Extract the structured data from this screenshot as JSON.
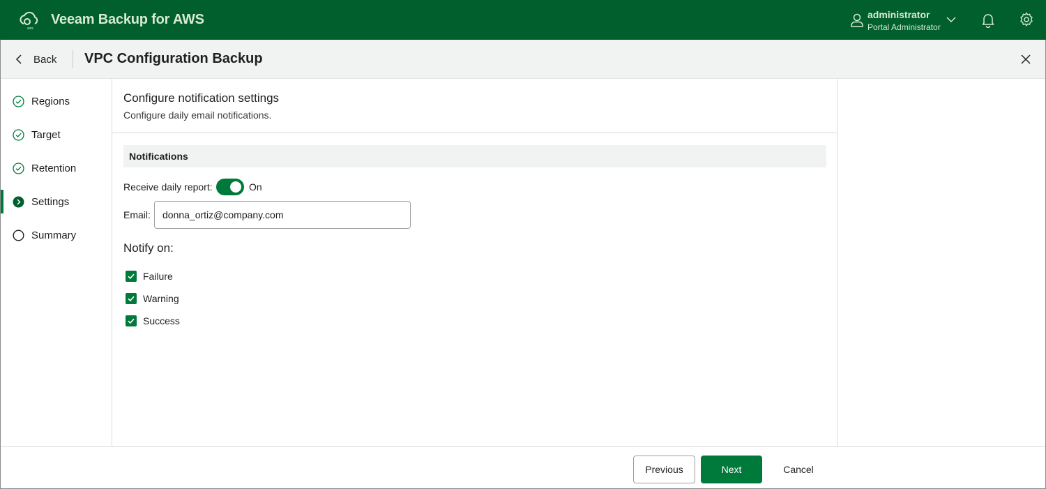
{
  "app": {
    "title": "Veeam Backup for AWS",
    "logo_icon": "veeam-cloud-logo",
    "user_name": "administrator",
    "user_role": "Portal Administrator",
    "icons": [
      "user-icon",
      "chevron-down-icon",
      "bell-icon",
      "gear-icon"
    ],
    "brand_color": "#005f2c",
    "accent_color": "#007a3b"
  },
  "header": {
    "back_label": "Back",
    "title": "VPC Configuration Backup",
    "close_icon": "close-icon"
  },
  "steps": [
    {
      "label": "Regions",
      "state": "completed"
    },
    {
      "label": "Target",
      "state": "completed"
    },
    {
      "label": "Retention",
      "state": "completed"
    },
    {
      "label": "Settings",
      "state": "current"
    },
    {
      "label": "Summary",
      "state": "pending"
    }
  ],
  "main": {
    "title": "Configure notification settings",
    "subtitle": "Configure daily email notifications.",
    "group_title": "Notifications",
    "daily_report_label": "Receive daily report:",
    "daily_report_on": true,
    "daily_report_state": "On",
    "email_label": "Email:",
    "email_value": "donna_ortiz@company.com",
    "notify_title": "Notify on:",
    "notify_options": [
      {
        "label": "Failure",
        "checked": true
      },
      {
        "label": "Warning",
        "checked": true
      },
      {
        "label": "Success",
        "checked": true
      }
    ]
  },
  "footer": {
    "previous_label": "Previous",
    "next_label": "Next",
    "cancel_label": "Cancel"
  }
}
